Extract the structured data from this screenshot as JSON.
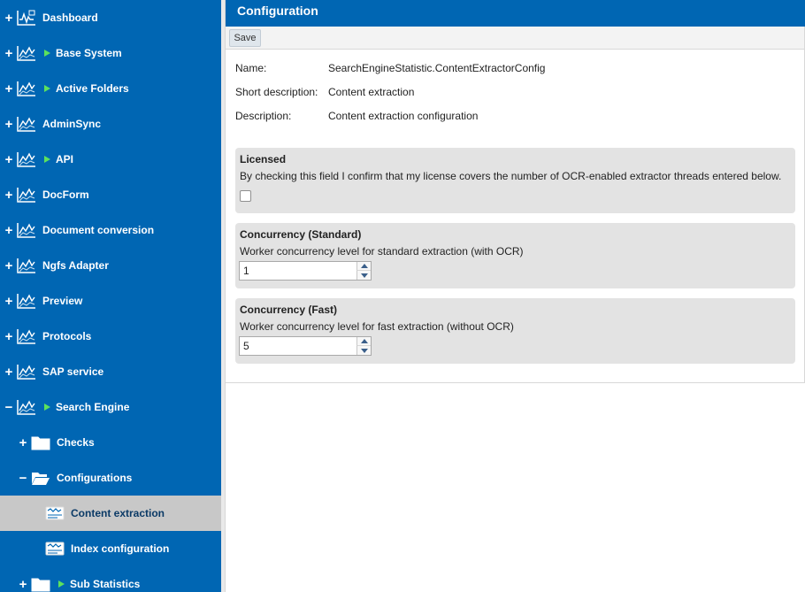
{
  "sidebar": {
    "items": [
      {
        "label": "Dashboard",
        "toggle": "+",
        "icon": "dashboard-chart-icon",
        "arrow": false
      },
      {
        "label": "Base System",
        "toggle": "+",
        "icon": "chart-icon",
        "arrow": true
      },
      {
        "label": "Active Folders",
        "toggle": "+",
        "icon": "chart-icon",
        "arrow": true
      },
      {
        "label": "AdminSync",
        "toggle": "+",
        "icon": "chart-icon",
        "arrow": false
      },
      {
        "label": "API",
        "toggle": "+",
        "icon": "chart-icon",
        "arrow": true
      },
      {
        "label": "DocForm",
        "toggle": "+",
        "icon": "chart-icon",
        "arrow": false
      },
      {
        "label": "Document conversion",
        "toggle": "+",
        "icon": "chart-icon",
        "arrow": false
      },
      {
        "label": "Ngfs Adapter",
        "toggle": "+",
        "icon": "chart-icon",
        "arrow": false
      },
      {
        "label": "Preview",
        "toggle": "+",
        "icon": "chart-icon",
        "arrow": false
      },
      {
        "label": "Protocols",
        "toggle": "+",
        "icon": "chart-icon",
        "arrow": false
      },
      {
        "label": "SAP service",
        "toggle": "+",
        "icon": "chart-icon",
        "arrow": false
      },
      {
        "label": "Search Engine",
        "toggle": "−",
        "icon": "chart-icon",
        "arrow": true
      },
      {
        "label": "Checks",
        "toggle": "+",
        "icon": "folder-icon",
        "arrow": false
      },
      {
        "label": "Configurations",
        "toggle": "−",
        "icon": "folder-open-icon",
        "arrow": false
      },
      {
        "label": "Content extraction",
        "toggle": "",
        "icon": "config-icon",
        "arrow": false,
        "selected": true
      },
      {
        "label": "Index configuration",
        "toggle": "",
        "icon": "config-icon",
        "arrow": false
      },
      {
        "label": "Sub Statistics",
        "toggle": "+",
        "icon": "folder-icon",
        "arrow": true
      }
    ]
  },
  "header": {
    "title": "Configuration"
  },
  "toolbar": {
    "save_label": "Save"
  },
  "meta": {
    "name_label": "Name:",
    "name_value": "SearchEngineStatistic.ContentExtractorConfig",
    "short_label": "Short description:",
    "short_value": "Content extraction",
    "desc_label": "Description:",
    "desc_value": "Content extraction configuration"
  },
  "licensed": {
    "title": "Licensed",
    "description": "By checking this field I confirm that my license covers the number of OCR-enabled extractor threads entered below.",
    "checked": false
  },
  "concurrency_standard": {
    "title": "Concurrency (Standard)",
    "description": "Worker concurrency level for standard extraction (with OCR)",
    "value": "1"
  },
  "concurrency_fast": {
    "title": "Concurrency (Fast)",
    "description": "Worker concurrency level for fast extraction (without OCR)",
    "value": "5"
  },
  "colors": {
    "sidebar_bg": "#0066b3",
    "selected_bg": "#c8c8c8",
    "arrow_green": "#5ce25c",
    "section_bg": "#e3e3e3"
  }
}
